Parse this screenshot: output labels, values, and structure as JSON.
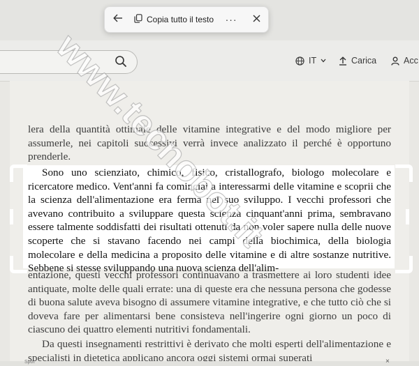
{
  "toolbar": {
    "back_icon": "arrow-left-icon",
    "copy_icon": "copy-icon",
    "copy_label": "Copia tutto il testo",
    "more_label": "···",
    "close_icon": "close-icon"
  },
  "header": {
    "search_icon": "search-icon",
    "language_icon": "globe-icon",
    "language_label": "IT",
    "upload_label": "Carica",
    "account_label": "Acc"
  },
  "document": {
    "paragraph_top": "lera della quantità ottimale delle vitamine integrative e del modo migliore per assumerle, nei capitoli successivi verrà invece analizzato il perché è opportuno prenderle.",
    "selected_text": "Sono uno scienziato, chimico, fisico, cristallografo, biologo molecolare e ricercatore medico. Vent'anni fa cominciai a interessarmi delle vitamine e scoprii che la scienza dell'alimentazione era ferma nel suo sviluppo. I vecchi professori che avevano contribuito a sviluppare questa scienza cinquant'anni prima, sembravano essere talmente soddisfatti dei risultati ottenuti da non voler sapere nulla delle nuove scoperte che si stavano facendo nei campi della biochimica, della biologia molecolare e della medicina a proposito delle vitamine e di altre sostanze nutritive. Sebbene si stesse sviluppando una nuova scienza dell'alim-",
    "paragraph_after": "entazione, questi vecchi professori continuavano a trasmettere ai loro studenti idee antiquate, molte delle quali errate: una di queste era che nessuna persona che godesse di buona salute aveva bisogno di assumere vitamine integrative, e che tutto ciò che si doveva fare per alimentarsi bene consisteva nell'ingerire ogni giorno un poco di ciascuno dei quattro elementi nutritivi fondamentali.",
    "paragraph_next": "Da questi insegnamenti restrittivi è derivato che molti esperti dell'alimentazione e specialisti in dietetica applicano ancora oggi sistemi ormai superati"
  },
  "footer": {
    "label": "Spot",
    "close": "×"
  },
  "watermark": {
    "text": "www.tecnobot.it"
  },
  "colors": {
    "selection_bg": "#ffffff",
    "page_bg": "#efeeea",
    "toolbar_bg": "#f7f7f7"
  }
}
